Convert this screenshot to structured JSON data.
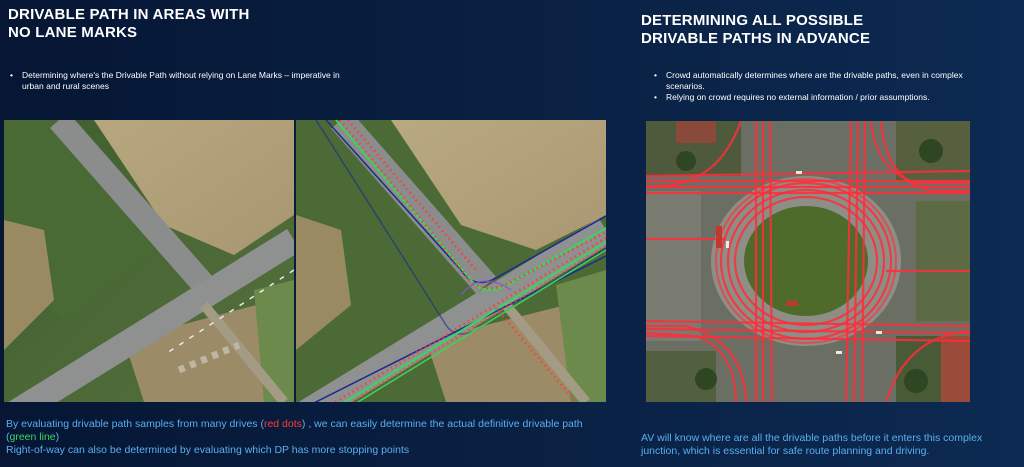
{
  "left": {
    "title": "DRIVABLE PATH IN AREAS WITH\nNO LANE MARKS",
    "bullet": "Determining where's the Drivable Path without relying on Lane Marks – imperative in urban and rural scenes",
    "caption_part1": "By evaluating drivable path samples from many drives (",
    "caption_red": "red dots",
    "caption_part2": ") , we can easily determine the actual definitive drivable path (",
    "caption_green": "green line",
    "caption_part3": ")",
    "caption_line2": "Right-of-way can also be determined by evaluating which DP has more stopping points",
    "image_raw": "aerial-intersection-raw",
    "image_annotated": "aerial-intersection-annotated"
  },
  "right": {
    "title": "DETERMINING ALL POSSIBLE\nDRIVABLE PATHS IN ADVANCE",
    "bullets": [
      "Crowd automatically determines where are the drivable paths, even in complex scenarios.",
      "Relying on crowd requires no external information / prior assumptions."
    ],
    "caption": "AV will know where are all the drivable paths before it enters this complex junction, which is essential for safe route planning and driving.",
    "image": "aerial-roundabout-crowd-paths"
  },
  "colors": {
    "background": "#071a3a",
    "caption_blue": "#5aaef0",
    "red_dots": "#ff3b3b",
    "green_line": "#39d65b",
    "path_red": "#ff2d3a"
  }
}
